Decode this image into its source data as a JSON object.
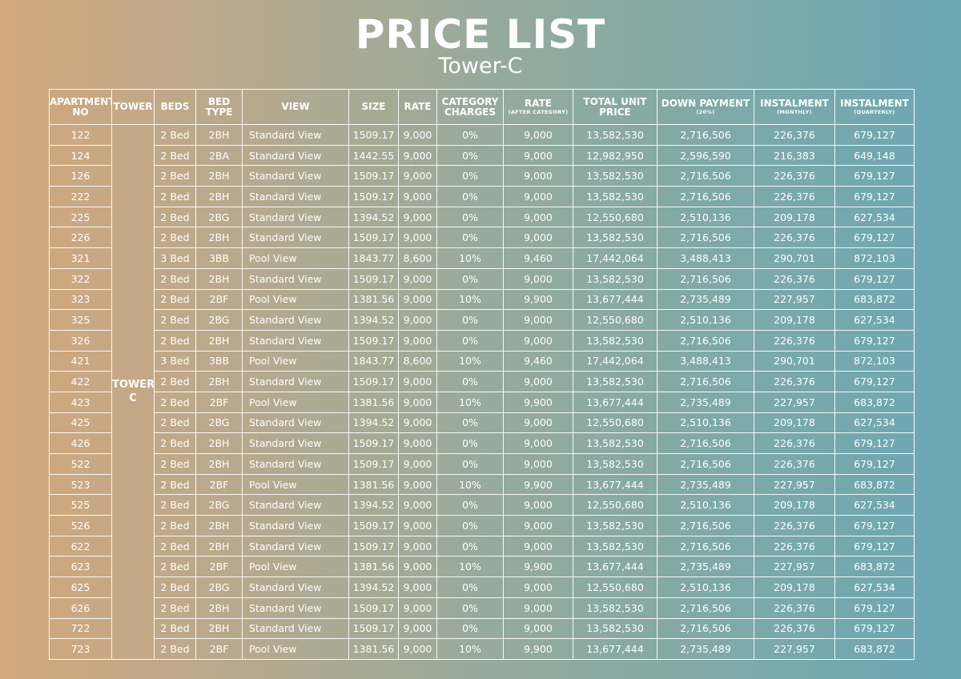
{
  "title": "PRICE LIST",
  "subtitle": "Tower-C",
  "tower_label": "TOWER C",
  "headers": [
    {
      "main": "APARTMENT NO",
      "sub": ""
    },
    {
      "main": "TOWER",
      "sub": ""
    },
    {
      "main": "BEDS",
      "sub": ""
    },
    {
      "main": "BED TYPE",
      "sub": ""
    },
    {
      "main": "VIEW",
      "sub": ""
    },
    {
      "main": "SIZE",
      "sub": ""
    },
    {
      "main": "RATE",
      "sub": ""
    },
    {
      "main": "CATEGORY CHARGES",
      "sub": ""
    },
    {
      "main": "RATE",
      "sub": "(AFTER CATEGORY)"
    },
    {
      "main": "TOTAL UNIT PRICE",
      "sub": ""
    },
    {
      "main": "DOWN PAYMENT",
      "sub": "(20%)"
    },
    {
      "main": "INSTALMENT",
      "sub": "(MONTHLY)"
    },
    {
      "main": "INSTALMENT",
      "sub": "(QUARTERLY)"
    }
  ],
  "rows": [
    [
      "122",
      "2 Bed",
      "2BH",
      "Standard View",
      "1509.17",
      "9,000",
      "0%",
      "9,000",
      "13,582,530",
      "2,716,506",
      "226,376",
      "679,127"
    ],
    [
      "124",
      "2 Bed",
      "2BA",
      "Standard View",
      "1442.55",
      "9,000",
      "0%",
      "9,000",
      "12,982,950",
      "2,596,590",
      "216,383",
      "649,148"
    ],
    [
      "126",
      "2 Bed",
      "2BH",
      "Standard View",
      "1509.17",
      "9,000",
      "0%",
      "9,000",
      "13,582,530",
      "2,716,506",
      "226,376",
      "679,127"
    ],
    [
      "222",
      "2 Bed",
      "2BH",
      "Standard View",
      "1509.17",
      "9,000",
      "0%",
      "9,000",
      "13,582,530",
      "2,716,506",
      "226,376",
      "679,127"
    ],
    [
      "225",
      "2 Bed",
      "2BG",
      "Standard View",
      "1394.52",
      "9,000",
      "0%",
      "9,000",
      "12,550,680",
      "2,510,136",
      "209,178",
      "627,534"
    ],
    [
      "226",
      "2 Bed",
      "2BH",
      "Standard View",
      "1509.17",
      "9,000",
      "0%",
      "9,000",
      "13,582,530",
      "2,716,506",
      "226,376",
      "679,127"
    ],
    [
      "321",
      "3 Bed",
      "3BB",
      "Pool View",
      "1843.77",
      "8,600",
      "10%",
      "9,460",
      "17,442,064",
      "3,488,413",
      "290,701",
      "872,103"
    ],
    [
      "322",
      "2 Bed",
      "2BH",
      "Standard View",
      "1509.17",
      "9,000",
      "0%",
      "9,000",
      "13,582,530",
      "2,716,506",
      "226,376",
      "679,127"
    ],
    [
      "323",
      "2 Bed",
      "2BF",
      "Pool View",
      "1381.56",
      "9,000",
      "10%",
      "9,900",
      "13,677,444",
      "2,735,489",
      "227,957",
      "683,872"
    ],
    [
      "325",
      "2 Bed",
      "2BG",
      "Standard View",
      "1394.52",
      "9,000",
      "0%",
      "9,000",
      "12,550,680",
      "2,510,136",
      "209,178",
      "627,534"
    ],
    [
      "326",
      "2 Bed",
      "2BH",
      "Standard View",
      "1509.17",
      "9,000",
      "0%",
      "9,000",
      "13,582,530",
      "2,716,506",
      "226,376",
      "679,127"
    ],
    [
      "421",
      "3 Bed",
      "3BB",
      "Pool View",
      "1843.77",
      "8,600",
      "10%",
      "9,460",
      "17,442,064",
      "3,488,413",
      "290,701",
      "872,103"
    ],
    [
      "422",
      "2 Bed",
      "2BH",
      "Standard View",
      "1509.17",
      "9,000",
      "0%",
      "9,000",
      "13,582,530",
      "2,716,506",
      "226,376",
      "679,127"
    ],
    [
      "423",
      "2 Bed",
      "2BF",
      "Pool View",
      "1381.56",
      "9,000",
      "10%",
      "9,900",
      "13,677,444",
      "2,735,489",
      "227,957",
      "683,872"
    ],
    [
      "425",
      "2 Bed",
      "2BG",
      "Standard View",
      "1394.52",
      "9,000",
      "0%",
      "9,000",
      "12,550,680",
      "2,510,136",
      "209,178",
      "627,534"
    ],
    [
      "426",
      "2 Bed",
      "2BH",
      "Standard View",
      "1509.17",
      "9,000",
      "0%",
      "9,000",
      "13,582,530",
      "2,716,506",
      "226,376",
      "679,127"
    ],
    [
      "522",
      "2 Bed",
      "2BH",
      "Standard View",
      "1509.17",
      "9,000",
      "0%",
      "9,000",
      "13,582,530",
      "2,716,506",
      "226,376",
      "679,127"
    ],
    [
      "523",
      "2 Bed",
      "2BF",
      "Pool View",
      "1381.56",
      "9,000",
      "10%",
      "9,900",
      "13,677,444",
      "2,735,489",
      "227,957",
      "683,872"
    ],
    [
      "525",
      "2 Bed",
      "2BG",
      "Standard View",
      "1394.52",
      "9,000",
      "0%",
      "9,000",
      "12,550,680",
      "2,510,136",
      "209,178",
      "627,534"
    ],
    [
      "526",
      "2 Bed",
      "2BH",
      "Standard View",
      "1509.17",
      "9,000",
      "0%",
      "9,000",
      "13,582,530",
      "2,716,506",
      "226,376",
      "679,127"
    ],
    [
      "622",
      "2 Bed",
      "2BH",
      "Standard View",
      "1509.17",
      "9,000",
      "0%",
      "9,000",
      "13,582,530",
      "2,716,506",
      "226,376",
      "679,127"
    ],
    [
      "623",
      "2 Bed",
      "2BF",
      "Pool View",
      "1381.56",
      "9,000",
      "10%",
      "9,900",
      "13,677,444",
      "2,735,489",
      "227,957",
      "683,872"
    ],
    [
      "625",
      "2 Bed",
      "2BG",
      "Standard View",
      "1394.52",
      "9,000",
      "0%",
      "9,000",
      "12,550,680",
      "2,510,136",
      "209,178",
      "627,534"
    ],
    [
      "626",
      "2 Bed",
      "2BH",
      "Standard View",
      "1509.17",
      "9,000",
      "0%",
      "9,000",
      "13,582,530",
      "2,716,506",
      "226,376",
      "679,127"
    ],
    [
      "722",
      "2 Bed",
      "2BH",
      "Standard View",
      "1509.17",
      "9,000",
      "0%",
      "9,000",
      "13,582,530",
      "2,716,506",
      "226,376",
      "679,127"
    ],
    [
      "723",
      "2 Bed",
      "2BF",
      "Pool View",
      "1381.56",
      "9,000",
      "10%",
      "9,900",
      "13,677,444",
      "2,735,489",
      "227,957",
      "683,872"
    ]
  ]
}
